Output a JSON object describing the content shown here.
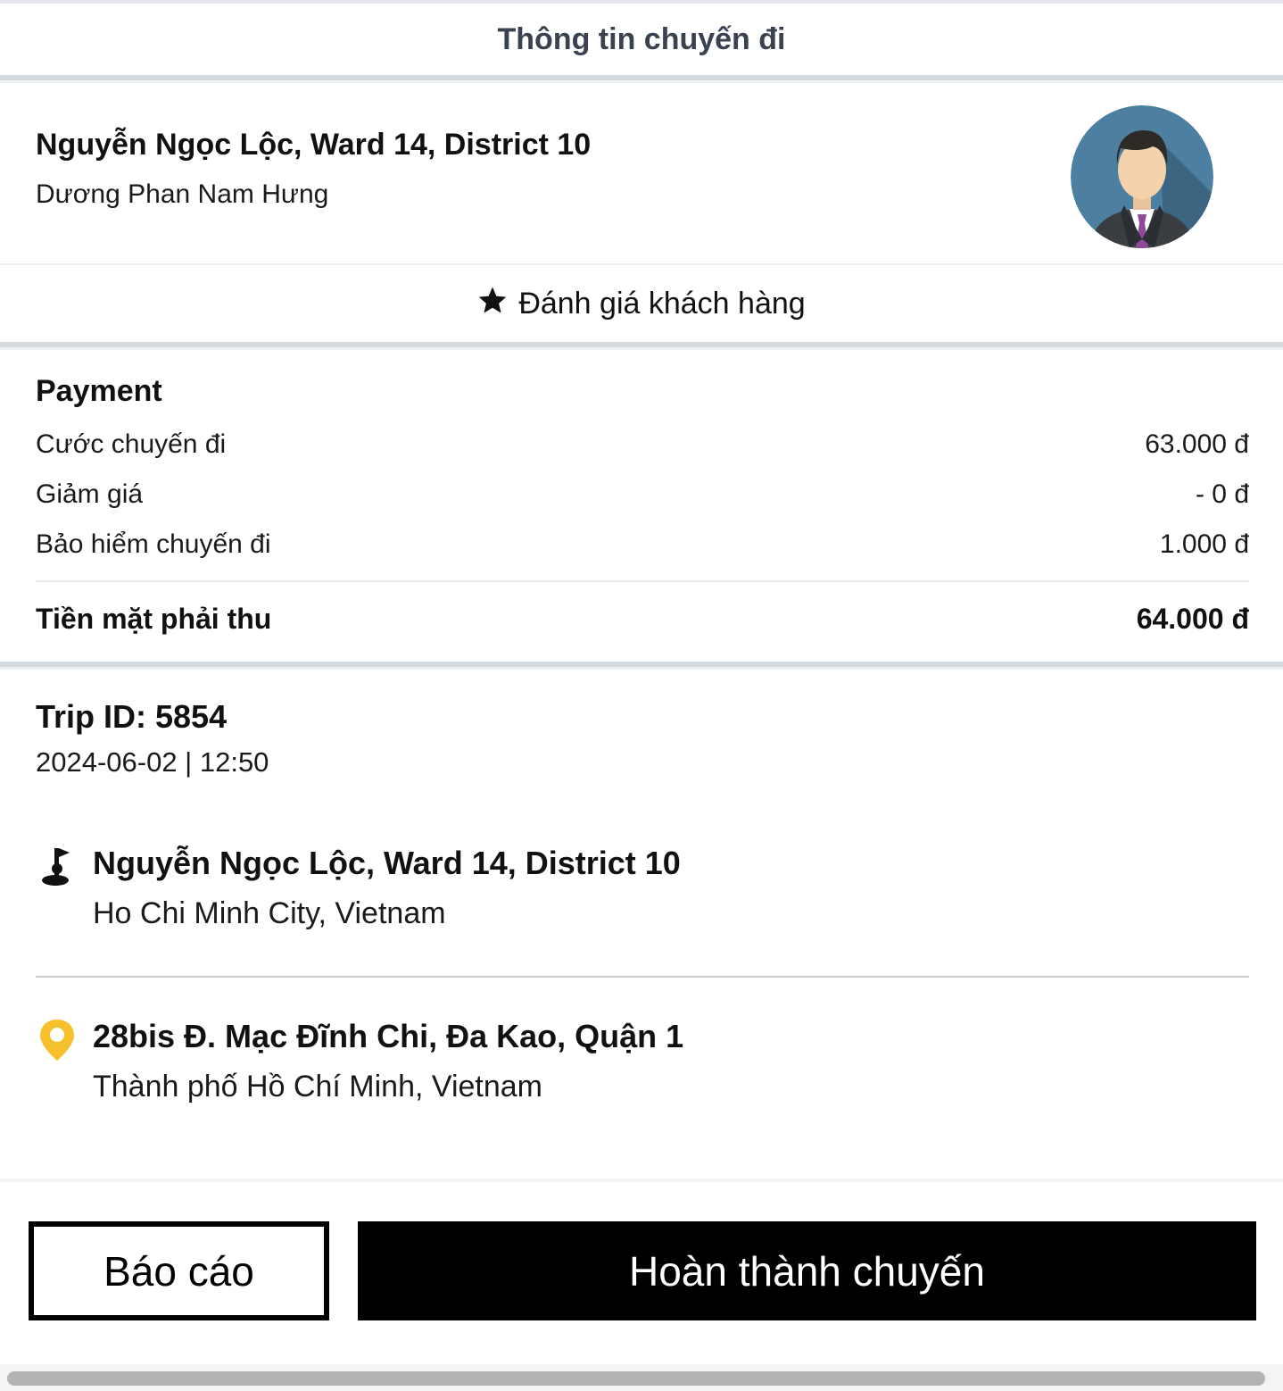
{
  "header": {
    "title": "Thông tin chuyến đi"
  },
  "customer": {
    "name": "Nguyễn Ngọc Lộc, Ward 14, District 10",
    "subtitle": "Dương Phan Nam Hưng"
  },
  "rate": {
    "icon": "star-icon",
    "label": "Đánh giá khách hàng"
  },
  "payment": {
    "title": "Payment",
    "rows": [
      {
        "label": "Cước chuyến đi",
        "value": "63.000 đ"
      },
      {
        "label": "Giảm giá",
        "value": "- 0 đ"
      },
      {
        "label": "Bảo hiểm chuyến đi",
        "value": "1.000 đ"
      }
    ],
    "total": {
      "label": "Tiền mặt phải thu",
      "value": "64.000 đ"
    }
  },
  "trip": {
    "id_text": "Trip ID: 5854",
    "datetime": "2024-06-02 | 12:50",
    "pickup": {
      "icon": "flag-icon",
      "main": "Nguyễn Ngọc Lộc, Ward 14, District 10",
      "sub": "Ho Chi Minh City, Vietnam"
    },
    "dropoff": {
      "icon": "location-pin-icon",
      "main": "28bis Đ. Mạc Đĩnh Chi, Đa Kao, Quận 1",
      "sub": "Thành phố Hồ Chí Minh, Vietnam",
      "color": "#f5c02c"
    }
  },
  "actions": {
    "report_label": "Báo cáo",
    "complete_label": "Hoàn thành chuyến"
  }
}
